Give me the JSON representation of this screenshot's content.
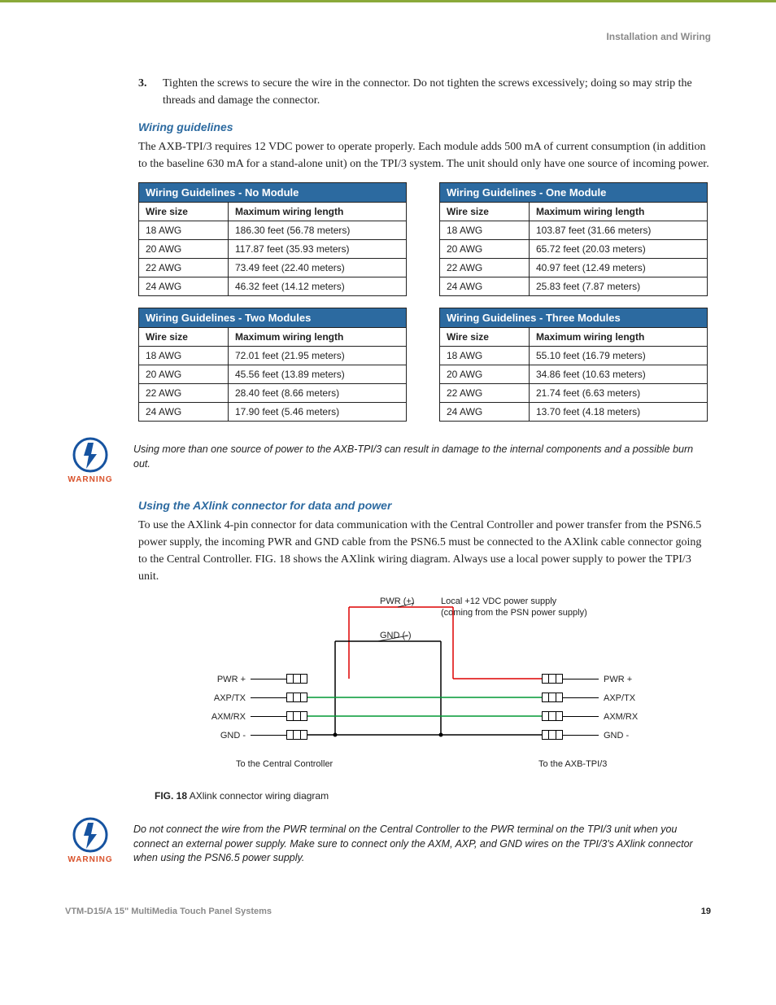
{
  "header": {
    "section_title": "Installation and Wiring"
  },
  "step3": {
    "num": "3.",
    "text": "Tighten the screws to secure the wire in the connector. Do not tighten the screws excessively; doing so may strip the threads and damage the connector."
  },
  "sec1": {
    "heading": "Wiring guidelines",
    "para": "The AXB-TPI/3 requires 12 VDC power to operate properly. Each module adds 500 mA of current consumption (in addition to the baseline 630 mA for a stand-alone unit) on the TPI/3 system. The unit should only have one source of incoming power."
  },
  "cols": {
    "c1": "Wire size",
    "c2": "Maximum wiring length"
  },
  "tables": [
    {
      "title": "Wiring Guidelines - No Module",
      "rows": [
        [
          "18 AWG",
          "186.30 feet (56.78 meters)"
        ],
        [
          "20 AWG",
          "117.87 feet (35.93 meters)"
        ],
        [
          "22 AWG",
          "73.49 feet (22.40 meters)"
        ],
        [
          "24 AWG",
          "46.32 feet (14.12 meters)"
        ]
      ]
    },
    {
      "title": "Wiring Guidelines - One Module",
      "rows": [
        [
          "18 AWG",
          "103.87 feet (31.66 meters)"
        ],
        [
          "20 AWG",
          "65.72 feet (20.03 meters)"
        ],
        [
          "22 AWG",
          "40.97 feet (12.49 meters)"
        ],
        [
          "24 AWG",
          "25.83 feet (7.87 meters)"
        ]
      ]
    },
    {
      "title": "Wiring Guidelines - Two Modules",
      "rows": [
        [
          "18 AWG",
          "72.01 feet (21.95 meters)"
        ],
        [
          "20 AWG",
          "45.56 feet (13.89 meters)"
        ],
        [
          "22 AWG",
          "28.40 feet (8.66 meters)"
        ],
        [
          "24 AWG",
          "17.90 feet (5.46 meters)"
        ]
      ]
    },
    {
      "title": "Wiring Guidelines - Three Modules",
      "rows": [
        [
          "18 AWG",
          "55.10 feet (16.79 meters)"
        ],
        [
          "20 AWG",
          "34.86 feet (10.63 meters)"
        ],
        [
          "22 AWG",
          "21.74 feet (6.63 meters)"
        ],
        [
          "24 AWG",
          "13.70 feet (4.18 meters)"
        ]
      ]
    }
  ],
  "warn1": {
    "label": "WARNING",
    "text": "Using more than one source of power to the AXB-TPI/3 can result in damage to the internal components and a possible burn out."
  },
  "sec2": {
    "heading": "Using the AXlink connector for data and power",
    "para": "To use the AXlink 4-pin connector for data communication with the Central Controller and power transfer from the PSN6.5 power supply, the incoming PWR and GND cable from the PSN6.5 must be connected to the AXlink cable connector going to the Central Controller. FIG. 18 shows the AXlink wiring diagram. Always use a local power supply to power the TPI/3 unit."
  },
  "diagram": {
    "pwr_plus": "PWR (+)",
    "gnd_minus": "GND (-)",
    "psn_line1": "Local +12 VDC power supply",
    "psn_line2": "(coming from the PSN power supply)",
    "pins": [
      "PWR +",
      "AXP/TX",
      "AXM/RX",
      "GND -"
    ],
    "to_left": "To the Central Controller",
    "to_right": "To the AXB-TPI/3",
    "caption_b": "FIG. 18",
    "caption_t": "  AXlink connector wiring diagram"
  },
  "warn2": {
    "label": "WARNING",
    "text": "Do not connect the wire from the PWR terminal on the Central Controller to the PWR terminal on the TPI/3 unit when you connect an external power supply. Make sure to connect only the AXM, AXP, and GND wires on the TPI/3's AXlink connector when using the PSN6.5 power supply."
  },
  "footer": {
    "doc": "VTM-D15/A 15\" MultiMedia Touch Panel Systems",
    "page": "19"
  }
}
